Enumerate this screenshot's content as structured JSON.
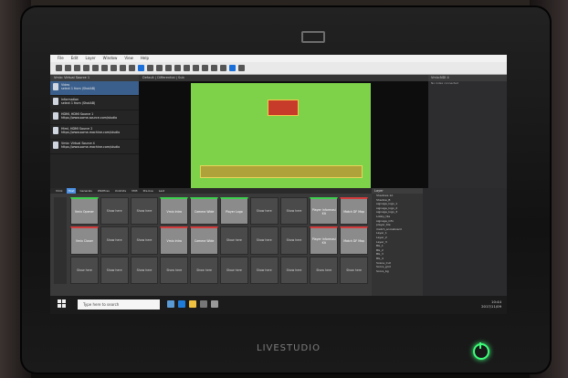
{
  "brand": "LIVESTUDIO",
  "menu": [
    "File",
    "Edit",
    "Layer",
    "Window",
    "View",
    "Help"
  ],
  "sources_panel": {
    "title": "Vmix: Virtual Source 1",
    "items": [
      {
        "title": "Video",
        "sub": "select 1 from (ShotAB)"
      },
      {
        "title": "Information",
        "sub": "select 1 from (ShotAB)"
      },
      {
        "title": "HDMI, HDMI Source 1",
        "sub": "https://www.some-source.com/studio"
      },
      {
        "title": "Html, HDMI Source 2",
        "sub": "https://www.some-machine.com/studio"
      },
      {
        "title": "Vmix: Virtual Source 4",
        "sub": "https://www.some-machine.com/studio"
      }
    ]
  },
  "center": {
    "tabs": "Default | Differential | Sub"
  },
  "right_panel": {
    "title": "Vmix:NDI 4",
    "sub": "No index connected"
  },
  "bottom_tabs": [
    "Vmix",
    "Host",
    "Generals",
    "Wildfires",
    "Unlimits",
    "",
    "VM3",
    "Pre-live",
    "Last"
  ],
  "grid": [
    {
      "label": "Vmix Opener",
      "style": "filled green"
    },
    {
      "label": "Show here",
      "style": ""
    },
    {
      "label": "Show here",
      "style": ""
    },
    {
      "label": "Vmix Intro",
      "style": "filled green"
    },
    {
      "label": "Camera Wide",
      "style": "filled green"
    },
    {
      "label": "Player Logo",
      "style": "filled green"
    },
    {
      "label": "Show here",
      "style": ""
    },
    {
      "label": "Show here",
      "style": ""
    },
    {
      "label": "Player Informasi Kit",
      "style": "filled green"
    },
    {
      "label": "Match DF Map",
      "style": "filled red"
    },
    {
      "label": "Vmix Closer",
      "style": "filled red"
    },
    {
      "label": "Show here",
      "style": ""
    },
    {
      "label": "Show here",
      "style": ""
    },
    {
      "label": "Vmix Intro",
      "style": "filled red"
    },
    {
      "label": "Camera Wide",
      "style": "filled red"
    },
    {
      "label": "Show here",
      "style": ""
    },
    {
      "label": "Show here",
      "style": ""
    },
    {
      "label": "Show here",
      "style": ""
    },
    {
      "label": "Player Informasi Kit",
      "style": "filled red"
    },
    {
      "label": "Match DF Map",
      "style": "filled red"
    },
    {
      "label": "Show here",
      "style": ""
    },
    {
      "label": "Show here",
      "style": ""
    },
    {
      "label": "Show here",
      "style": ""
    },
    {
      "label": "Show here",
      "style": ""
    },
    {
      "label": "Show here",
      "style": ""
    },
    {
      "label": "Show here",
      "style": ""
    },
    {
      "label": "Show here",
      "style": ""
    },
    {
      "label": "Show here",
      "style": ""
    },
    {
      "label": "Show here",
      "style": ""
    },
    {
      "label": "Show here",
      "style": ""
    }
  ],
  "layers": {
    "title": "Layer",
    "items": [
      "Shadows 1A",
      "Shadow_B",
      "signage_logo_1",
      "signage_logo_2",
      "signage_logo_3",
      "Lobby_tile",
      "signage_info",
      "player_tile",
      "match_scoreboard",
      "Layer_1",
      "Layer_2",
      "Layer_3",
      "BG_1",
      "BG_2",
      "BG_3",
      "BG_4",
      "Scene_Cut",
      "Score_grid",
      "Score_bg"
    ]
  },
  "taskbar": {
    "search": "Type here to search",
    "time": "10:44",
    "date": "2017/11/09"
  }
}
